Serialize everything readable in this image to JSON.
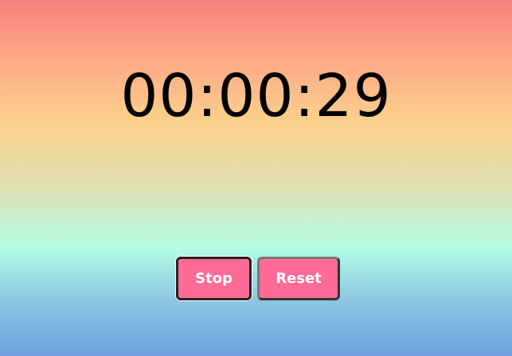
{
  "timer": {
    "display": "00:00:29"
  },
  "controls": {
    "stop_label": "Stop",
    "reset_label": "Reset"
  },
  "colors": {
    "button": "#fe6b96",
    "gradient_top": "#fa8080",
    "gradient_bottom": "#70a0e2"
  }
}
